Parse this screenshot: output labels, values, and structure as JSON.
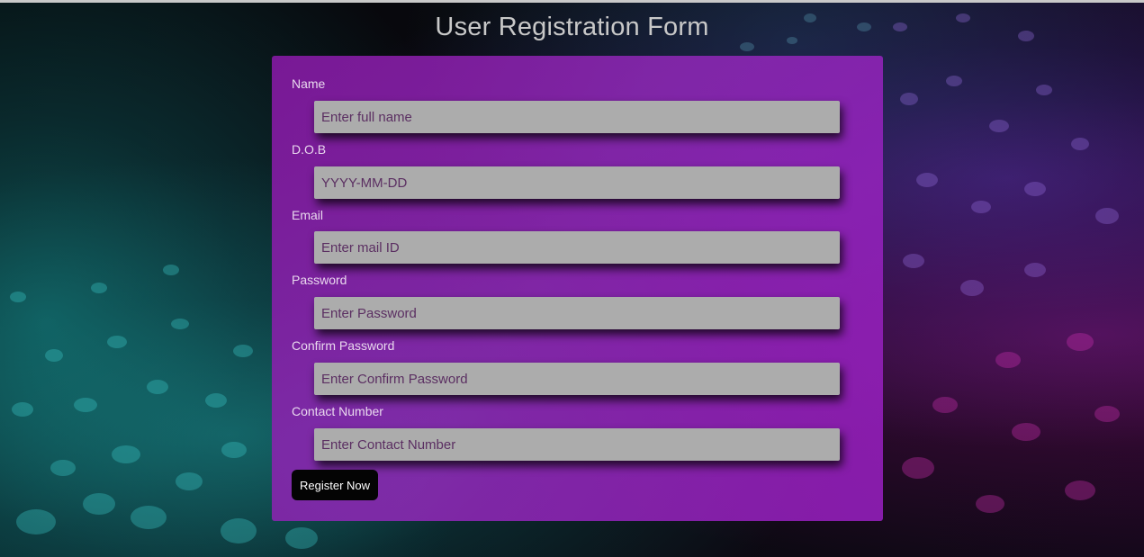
{
  "page": {
    "title": "User Registration Form"
  },
  "form": {
    "fields": [
      {
        "label": "Name",
        "placeholder": "Enter full name",
        "value": ""
      },
      {
        "label": "D.O.B",
        "placeholder": "YYYY-MM-DD",
        "value": ""
      },
      {
        "label": "Email",
        "placeholder": "Enter mail ID",
        "value": ""
      },
      {
        "label": "Password",
        "placeholder": "Enter Password",
        "value": ""
      },
      {
        "label": "Confirm Password",
        "placeholder": "Enter Confirm Password",
        "value": ""
      },
      {
        "label": "Contact Number",
        "placeholder": "Enter Contact Number",
        "value": ""
      }
    ],
    "submit_label": "Register Now"
  },
  "colors": {
    "card_background": "#8e22b4",
    "input_background": "#acacac",
    "button_background": "#040404",
    "title_text": "#c8c8c8"
  }
}
